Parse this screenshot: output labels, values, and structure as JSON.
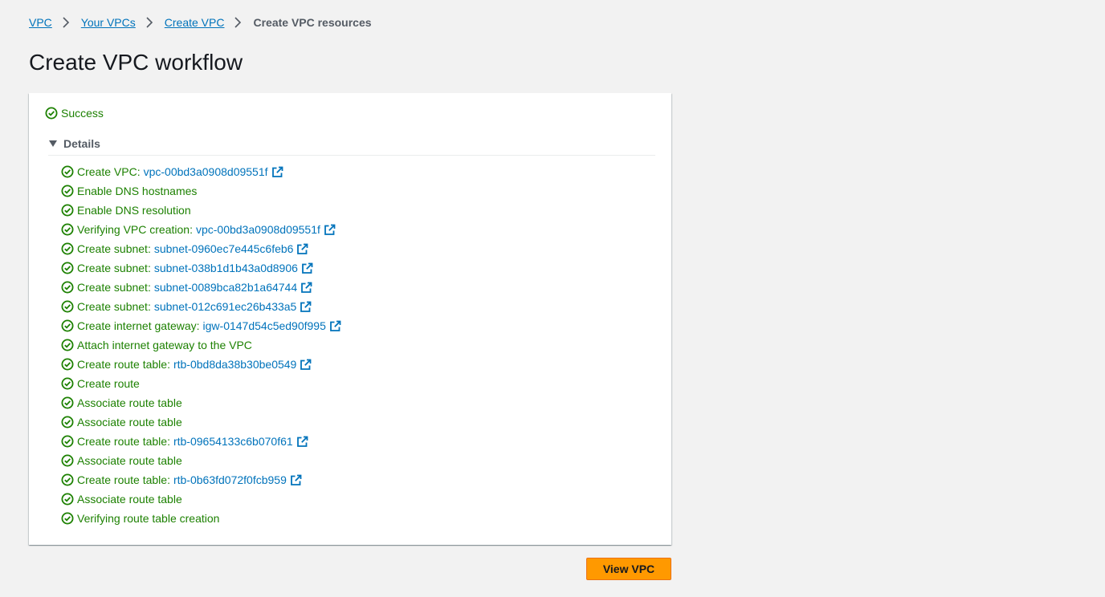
{
  "breadcrumb": {
    "items": [
      "VPC",
      "Your VPCs",
      "Create VPC"
    ],
    "current": "Create VPC resources"
  },
  "page": {
    "title": "Create VPC workflow"
  },
  "status": {
    "label": "Success"
  },
  "details": {
    "label": "Details",
    "steps": [
      {
        "text": "Create VPC:",
        "link": "vpc-00bd3a0908d09551f"
      },
      {
        "text": "Enable DNS hostnames",
        "link": null
      },
      {
        "text": "Enable DNS resolution",
        "link": null
      },
      {
        "text": "Verifying VPC creation:",
        "link": "vpc-00bd3a0908d09551f"
      },
      {
        "text": "Create subnet:",
        "link": "subnet-0960ec7e445c6feb6"
      },
      {
        "text": "Create subnet:",
        "link": "subnet-038b1d1b43a0d8906"
      },
      {
        "text": "Create subnet:",
        "link": "subnet-0089bca82b1a64744"
      },
      {
        "text": "Create subnet:",
        "link": "subnet-012c691ec26b433a5"
      },
      {
        "text": "Create internet gateway:",
        "link": "igw-0147d54c5ed90f995"
      },
      {
        "text": "Attach internet gateway to the VPC",
        "link": null
      },
      {
        "text": "Create route table:",
        "link": "rtb-0bd8da38b30be0549"
      },
      {
        "text": "Create route",
        "link": null
      },
      {
        "text": "Associate route table",
        "link": null
      },
      {
        "text": "Associate route table",
        "link": null
      },
      {
        "text": "Create route table:",
        "link": "rtb-09654133c6b070f61"
      },
      {
        "text": "Associate route table",
        "link": null
      },
      {
        "text": "Create route table:",
        "link": "rtb-0b63fd072f0fcb959"
      },
      {
        "text": "Associate route table",
        "link": null
      },
      {
        "text": "Verifying route table creation",
        "link": null
      }
    ]
  },
  "actions": {
    "view_vpc": "View VPC"
  },
  "colors": {
    "success": "#1d8102",
    "link": "#0073bb",
    "primary_button": "#ff9900"
  },
  "icons": {
    "status": "check-circle-icon",
    "link": "external-link-icon",
    "separator": "chevron-right-icon",
    "expand": "caret-down-icon"
  }
}
